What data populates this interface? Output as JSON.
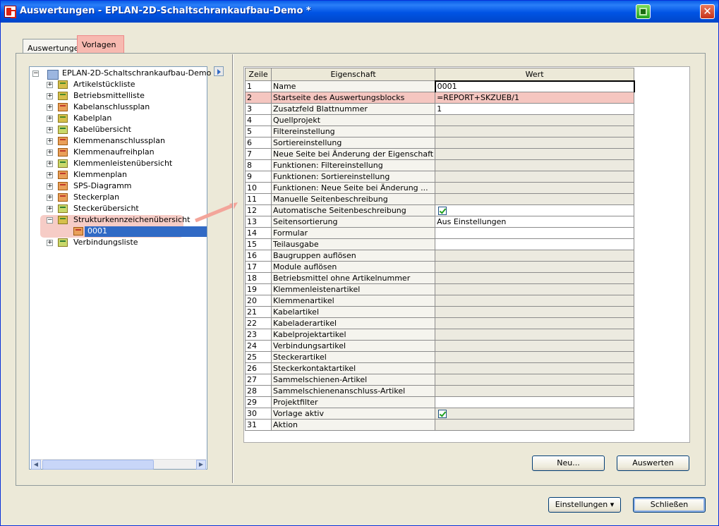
{
  "window": {
    "title": "Auswertungen - EPLAN-2D-Schaltschrankaufbau-Demo *"
  },
  "tabs": [
    {
      "label": "Auswertungen"
    },
    {
      "label": "Vorlagen"
    }
  ],
  "tree": {
    "root": "EPLAN-2D-Schaltschrankaufbau-Demo",
    "items": [
      {
        "label": "Artikelstückliste",
        "color": "yellow"
      },
      {
        "label": "Betriebsmittelliste",
        "color": "yellow"
      },
      {
        "label": "Kabelanschlussplan",
        "color": "red"
      },
      {
        "label": "Kabelplan",
        "color": "yellow"
      },
      {
        "label": "Kabelübersicht",
        "color": "green"
      },
      {
        "label": "Klemmenanschlussplan",
        "color": "red"
      },
      {
        "label": "Klemmenaufreihplan",
        "color": "red"
      },
      {
        "label": "Klemmenleistenübersicht",
        "color": "green"
      },
      {
        "label": "Klemmenplan",
        "color": "red"
      },
      {
        "label": "SPS-Diagramm",
        "color": "red"
      },
      {
        "label": "Steckerplan",
        "color": "red"
      },
      {
        "label": "Steckerübersicht",
        "color": "green"
      },
      {
        "label": "Strukturkennzeichenübersicht",
        "color": "yellow"
      },
      {
        "label": "0001",
        "color": "red",
        "child": true
      },
      {
        "label": "Verbindungsliste",
        "color": "green"
      }
    ]
  },
  "grid": {
    "headers": {
      "row": "Zeile",
      "prop": "Eigenschaft",
      "value": "Wert"
    },
    "rows": [
      {
        "n": "1",
        "prop": "Name",
        "value": "0001"
      },
      {
        "n": "2",
        "prop": "Startseite des Auswertungsblocks",
        "value": "=REPORT+SKZUEB/1"
      },
      {
        "n": "3",
        "prop": "Zusatzfeld Blattnummer",
        "value": "1"
      },
      {
        "n": "4",
        "prop": "Quellprojekt",
        "value": ""
      },
      {
        "n": "5",
        "prop": "Filtereinstellung",
        "value": ""
      },
      {
        "n": "6",
        "prop": "Sortiereinstellung",
        "value": ""
      },
      {
        "n": "7",
        "prop": "Neue Seite bei Änderung der Eigenschaft",
        "value": ""
      },
      {
        "n": "8",
        "prop": "Funktionen: Filtereinstellung",
        "value": ""
      },
      {
        "n": "9",
        "prop": "Funktionen: Sortiereinstellung",
        "value": ""
      },
      {
        "n": "10",
        "prop": "Funktionen: Neue Seite bei Änderung ...",
        "value": ""
      },
      {
        "n": "11",
        "prop": "Manuelle Seitenbeschreibung",
        "value": ""
      },
      {
        "n": "12",
        "prop": "Automatische Seitenbeschreibung",
        "value": "",
        "check": true
      },
      {
        "n": "13",
        "prop": "Seitensortierung",
        "value": "Aus Einstellungen"
      },
      {
        "n": "14",
        "prop": "Formular",
        "value": ""
      },
      {
        "n": "15",
        "prop": "Teilausgabe",
        "value": ""
      },
      {
        "n": "16",
        "prop": "Baugruppen auflösen",
        "value": ""
      },
      {
        "n": "17",
        "prop": "Module auflösen",
        "value": ""
      },
      {
        "n": "18",
        "prop": "Betriebsmittel ohne Artikelnummer",
        "value": ""
      },
      {
        "n": "19",
        "prop": "Klemmenleistenartikel",
        "value": ""
      },
      {
        "n": "20",
        "prop": "Klemmenartikel",
        "value": ""
      },
      {
        "n": "21",
        "prop": "Kabelartikel",
        "value": ""
      },
      {
        "n": "22",
        "prop": "Kabeladerartikel",
        "value": ""
      },
      {
        "n": "23",
        "prop": "Kabelprojektartikel",
        "value": ""
      },
      {
        "n": "24",
        "prop": "Verbindungsartikel",
        "value": ""
      },
      {
        "n": "25",
        "prop": "Steckerartikel",
        "value": ""
      },
      {
        "n": "26",
        "prop": "Steckerkontaktartikel",
        "value": ""
      },
      {
        "n": "27",
        "prop": "Sammelschienen-Artikel",
        "value": ""
      },
      {
        "n": "28",
        "prop": "Sammelschienenanschluss-Artikel",
        "value": ""
      },
      {
        "n": "29",
        "prop": "Projektfilter",
        "value": ""
      },
      {
        "n": "30",
        "prop": "Vorlage aktiv",
        "value": "",
        "check": true
      },
      {
        "n": "31",
        "prop": "Aktion",
        "value": ""
      }
    ]
  },
  "buttons": {
    "new": "Neu...",
    "evaluate": "Auswerten",
    "settings": "Einstellungen",
    "close": "Schließen"
  }
}
